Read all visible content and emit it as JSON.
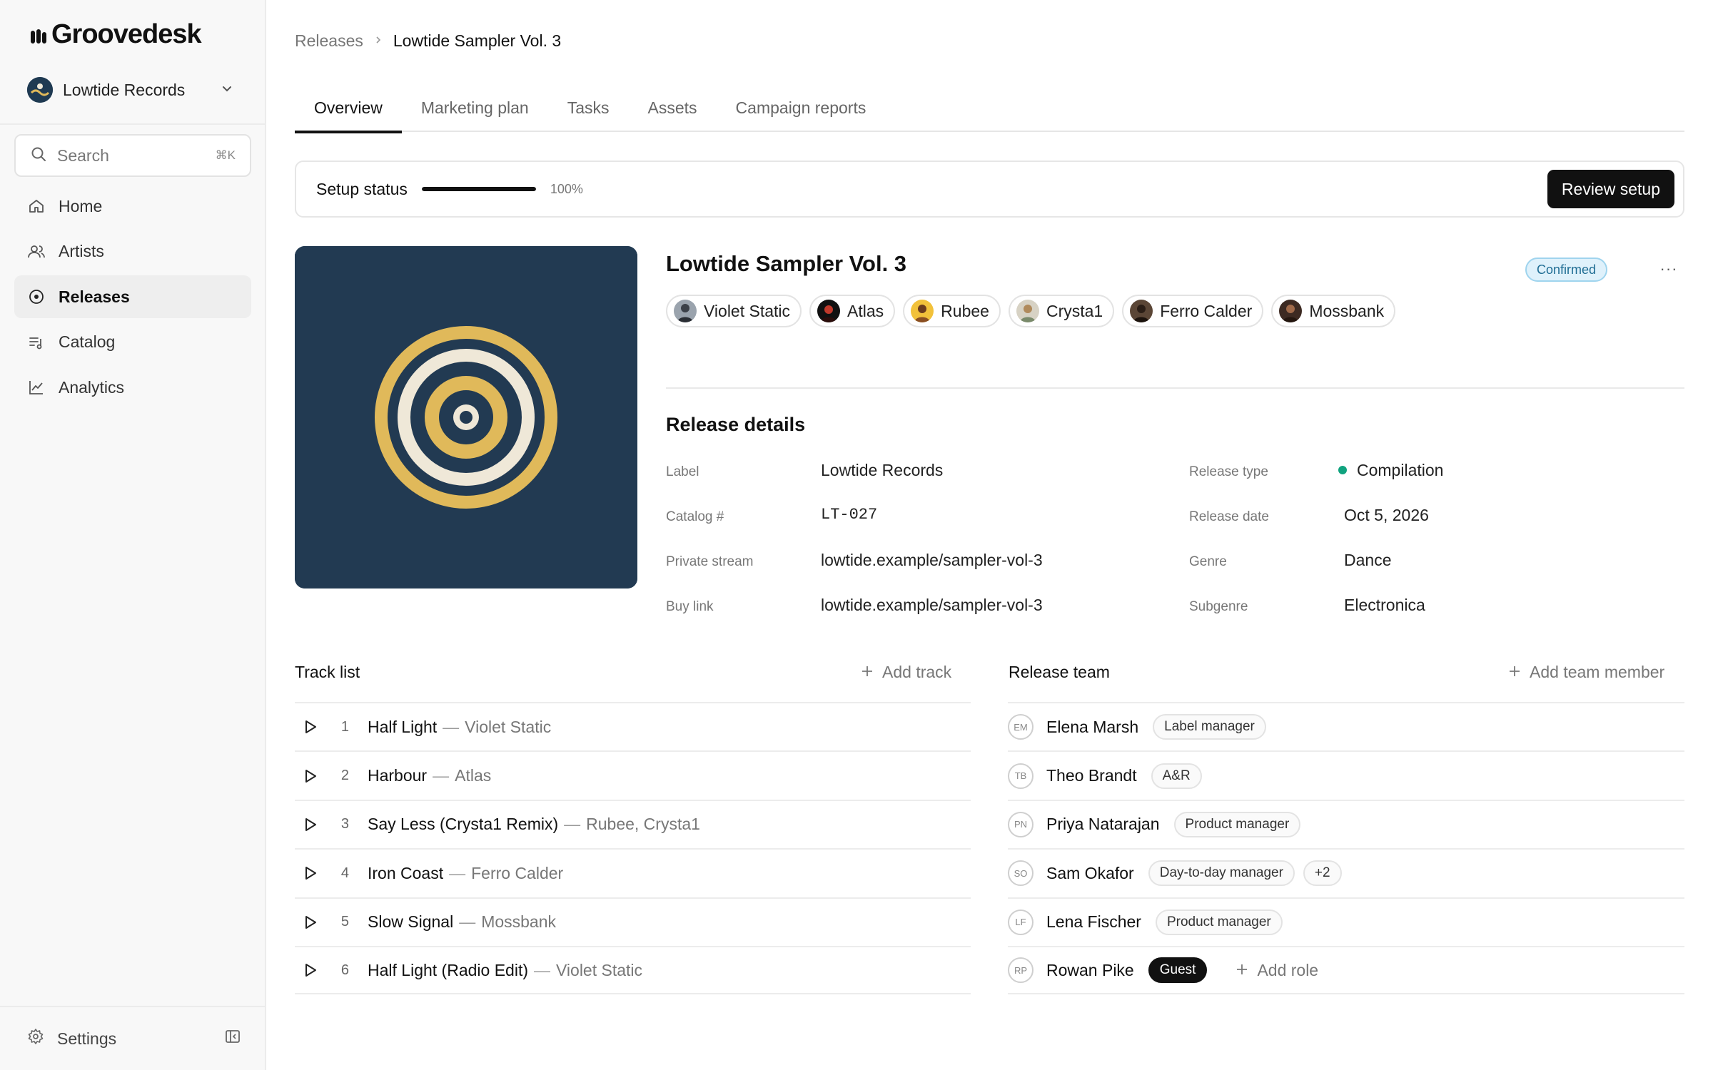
{
  "app": {
    "brand": "Groovedesk"
  },
  "workspace": {
    "name": "Lowtide Records"
  },
  "search": {
    "placeholder": "Search",
    "shortcut": "⌘K"
  },
  "sidebar": {
    "items": [
      {
        "label": "Home",
        "icon": "home-icon"
      },
      {
        "label": "Artists",
        "icon": "users-icon"
      },
      {
        "label": "Releases",
        "icon": "disc-icon",
        "active": true
      },
      {
        "label": "Catalog",
        "icon": "list-music-icon"
      },
      {
        "label": "Analytics",
        "icon": "chart-line-icon"
      }
    ],
    "settings_label": "Settings"
  },
  "breadcrumb": {
    "parent": "Releases",
    "current": "Lowtide Sampler Vol. 3"
  },
  "tabs": [
    "Overview",
    "Marketing plan",
    "Tasks",
    "Assets",
    "Campaign reports"
  ],
  "setup": {
    "label": "Setup status",
    "progress_text": "100%",
    "progress_value": 1.0,
    "button_label": "Review setup"
  },
  "release": {
    "title": "Lowtide Sampler Vol. 3",
    "status": "Confirmed",
    "more_label": "···",
    "artists": [
      "Violet Static",
      "Atlas",
      "Rubee",
      "Crysta1",
      "Ferro Calder",
      "Mossbank"
    ]
  },
  "details": {
    "title": "Release details",
    "label_label": "Label",
    "label_value": "Lowtide Records",
    "catalog_label": "Catalog #",
    "catalog_value": "LT-027",
    "stream_label": "Private stream",
    "stream_value": "lowtide.example/sampler-vol-3",
    "buy_label": "Buy link",
    "buy_value": "lowtide.example/sampler-vol-3",
    "type_label": "Release type",
    "type_value": "Compilation",
    "date_label": "Release date",
    "date_value": "Oct 5, 2026",
    "genre_label": "Genre",
    "genre_value": "Dance",
    "subgenre_label": "Subgenre",
    "subgenre_value": "Electronica"
  },
  "tracklist": {
    "title": "Track list",
    "add_label": "Add track",
    "tracks": [
      {
        "num": "1",
        "title": "Half Light",
        "artist": "Violet Static"
      },
      {
        "num": "2",
        "title": "Harbour",
        "artist": "Atlas"
      },
      {
        "num": "3",
        "title": "Say Less (Crysta1 Remix)",
        "artist": "Rubee, Crysta1"
      },
      {
        "num": "4",
        "title": "Iron Coast",
        "artist": "Ferro Calder"
      },
      {
        "num": "5",
        "title": "Slow Signal",
        "artist": "Mossbank"
      },
      {
        "num": "6",
        "title": "Half Light (Radio Edit)",
        "artist": "Violet Static"
      }
    ],
    "dash": "—"
  },
  "team": {
    "title": "Release team",
    "add_label": "Add team member",
    "add_role_label": "Add role",
    "members": [
      {
        "initials": "EM",
        "name": "Elena Marsh",
        "role": "Label manager"
      },
      {
        "initials": "TB",
        "name": "Theo Brandt",
        "role": "A&R"
      },
      {
        "initials": "PN",
        "name": "Priya Natarajan",
        "role": "Product manager"
      },
      {
        "initials": "SO",
        "name": "Sam Okafor",
        "role": "Day-to-day manager",
        "extra": "+2"
      },
      {
        "initials": "LF",
        "name": "Lena Fischer",
        "role": "Product manager"
      },
      {
        "initials": "RP",
        "name": "Rowan Pike",
        "role": "Guest"
      }
    ]
  },
  "colors": {
    "cover_bg": "#223a52",
    "cover_gold": "#e0b95a",
    "cover_cream": "#efe8d8",
    "status_green": "#10a37f",
    "confirmed_blue": "#dff1fb"
  }
}
